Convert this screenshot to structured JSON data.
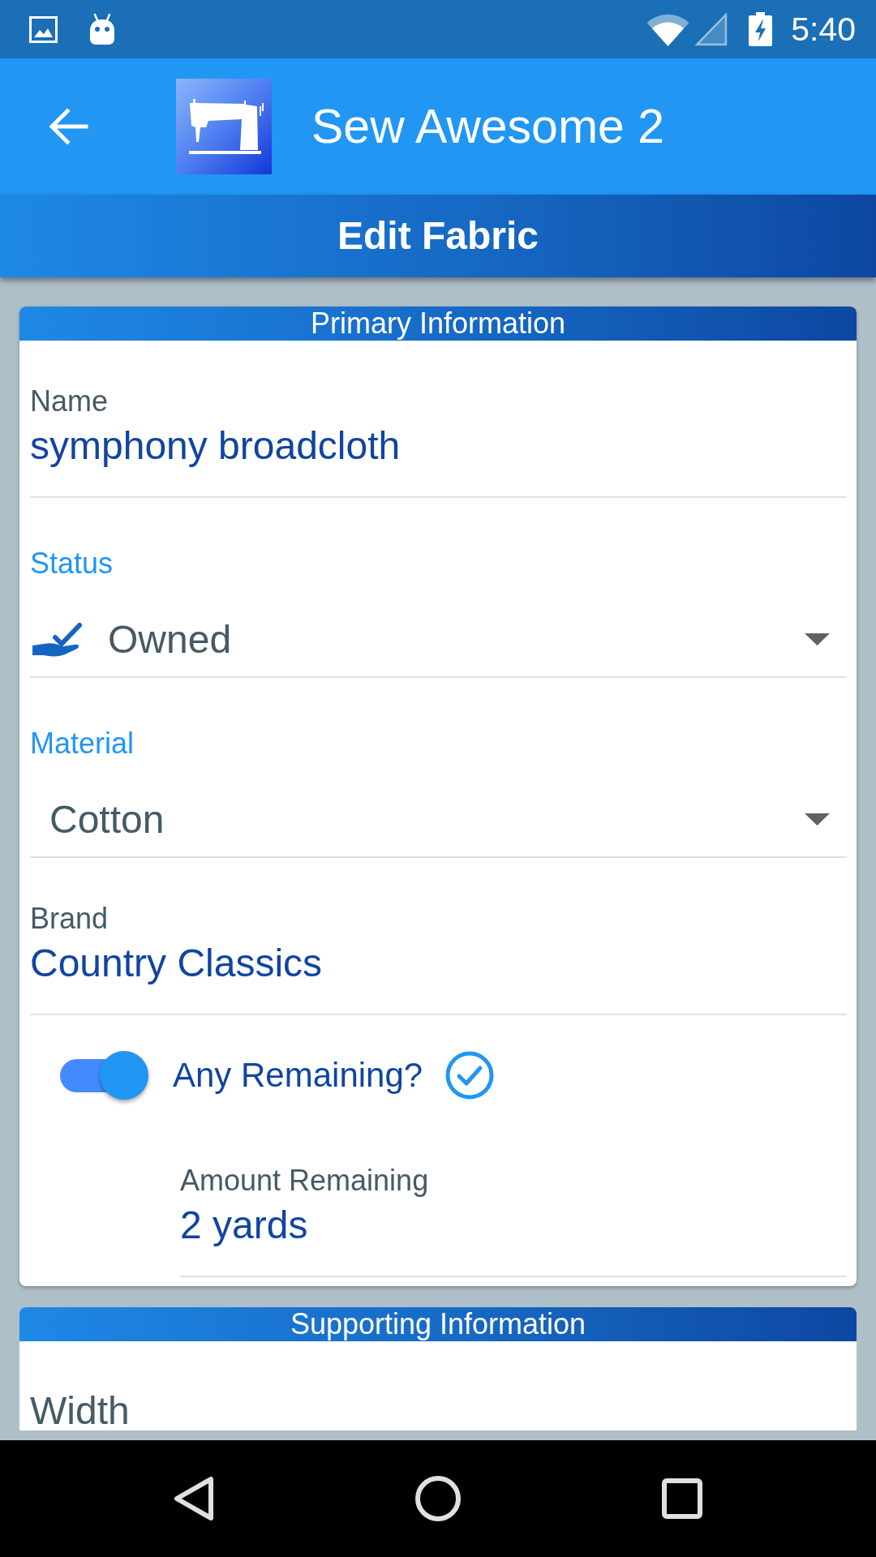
{
  "status_bar": {
    "time": "5:40"
  },
  "app_bar": {
    "title": "Sew Awesome 2"
  },
  "page_header": {
    "title": "Edit Fabric"
  },
  "sections": [
    {
      "title": "Primary Information",
      "fields": [
        {
          "kind": "text",
          "label": "Name",
          "value": "symphony broadcloth"
        },
        {
          "kind": "icon_dropdown",
          "label": "Status",
          "value": "Owned"
        },
        {
          "kind": "dropdown",
          "label": "Material",
          "value": "Cotton"
        },
        {
          "kind": "text",
          "label": "Brand",
          "value": "Country Classics"
        },
        {
          "kind": "toggle",
          "label": "Any Remaining?",
          "on": true
        },
        {
          "kind": "sub_text",
          "label": "Amount Remaining",
          "value": "2 yards"
        }
      ]
    },
    {
      "title": "Supporting Information",
      "fields": [
        {
          "kind": "empty_text",
          "label": "Width"
        }
      ]
    }
  ]
}
